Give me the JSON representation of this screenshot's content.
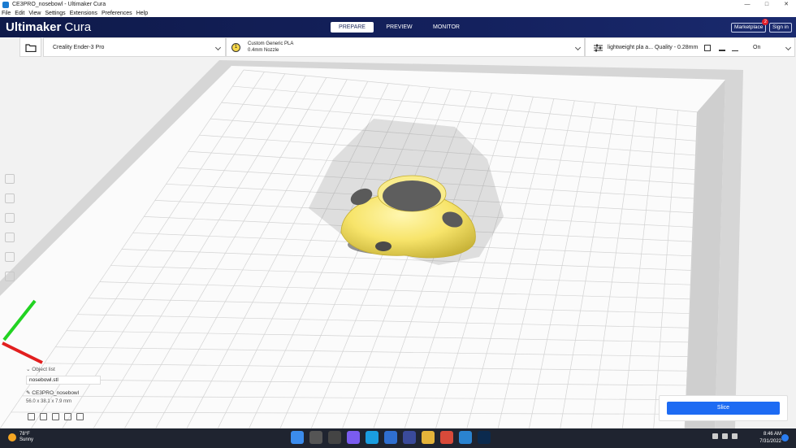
{
  "window": {
    "title": "CE3PRO_nosebowl - Ultimaker Cura",
    "controls": [
      "—",
      "□",
      "✕"
    ]
  },
  "menubar": [
    "File",
    "Edit",
    "View",
    "Settings",
    "Extensions",
    "Preferences",
    "Help"
  ],
  "header": {
    "logo_brand": "Ultimaker",
    "logo_product": "Cura",
    "stages": [
      "PREPARE",
      "PREVIEW",
      "MONITOR"
    ],
    "active_stage": "PREPARE",
    "marketplace_label": "Marketplace",
    "marketplace_badge": "2",
    "signin_label": "Sign in"
  },
  "toolbar": {
    "printer": "Creality Ender-3 Pro",
    "material_slot": "1",
    "material_name": "Custom Generic PLA",
    "nozzle": "0.4mm Nozzle",
    "profile": "lightweight pla a... Quality - 0.28mm",
    "support": "On"
  },
  "object_list": {
    "header": "Object list",
    "items": [
      "nosebowl.stl"
    ],
    "job_name": "CE3PRO_nosebowl",
    "dimensions": "56.0 x 38.1 x 7.9 mm"
  },
  "slice": {
    "button_label": "Slice"
  },
  "taskbar": {
    "temperature": "78°F",
    "weather": "Sunny",
    "time": "8:46 AM",
    "date": "7/31/2022"
  },
  "colors": {
    "header_bg": "#14215e",
    "slice_button": "#1d6bf3",
    "model_yellow": "#f7e46a",
    "badge_red": "#e21f2a"
  }
}
